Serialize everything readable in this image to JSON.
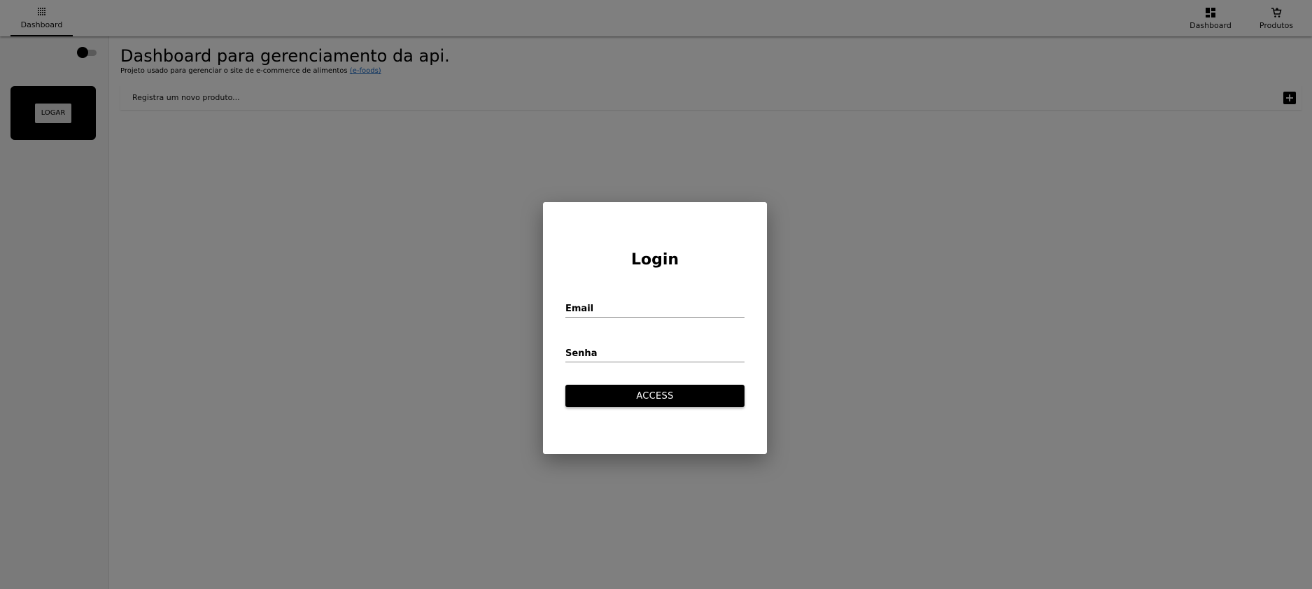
{
  "topbar": {
    "left_tab": {
      "label": "Dashboard",
      "icon": "apps-grid-icon"
    },
    "right_tabs": [
      {
        "label": "Dashboard",
        "icon": "dashboard-icon"
      },
      {
        "label": "Produtos",
        "icon": "cart-icon"
      }
    ]
  },
  "sidebar": {
    "login_button": "LOGAR"
  },
  "main": {
    "title": "Dashboard para gerenciamento da api.",
    "subtitle": "Projeto usado para gerenciar o site de e-commerce de alimentos",
    "subtitle_link": "(e-foods)",
    "register_placeholder": "Registra um novo produto..."
  },
  "modal": {
    "title": "Login",
    "email_label": "Email",
    "password_label": "Senha",
    "access_button": "ACCESS"
  },
  "colors": {
    "primary": "#000000",
    "link": "#1565c0",
    "backdrop": "rgba(0,0,0,0.5)"
  }
}
